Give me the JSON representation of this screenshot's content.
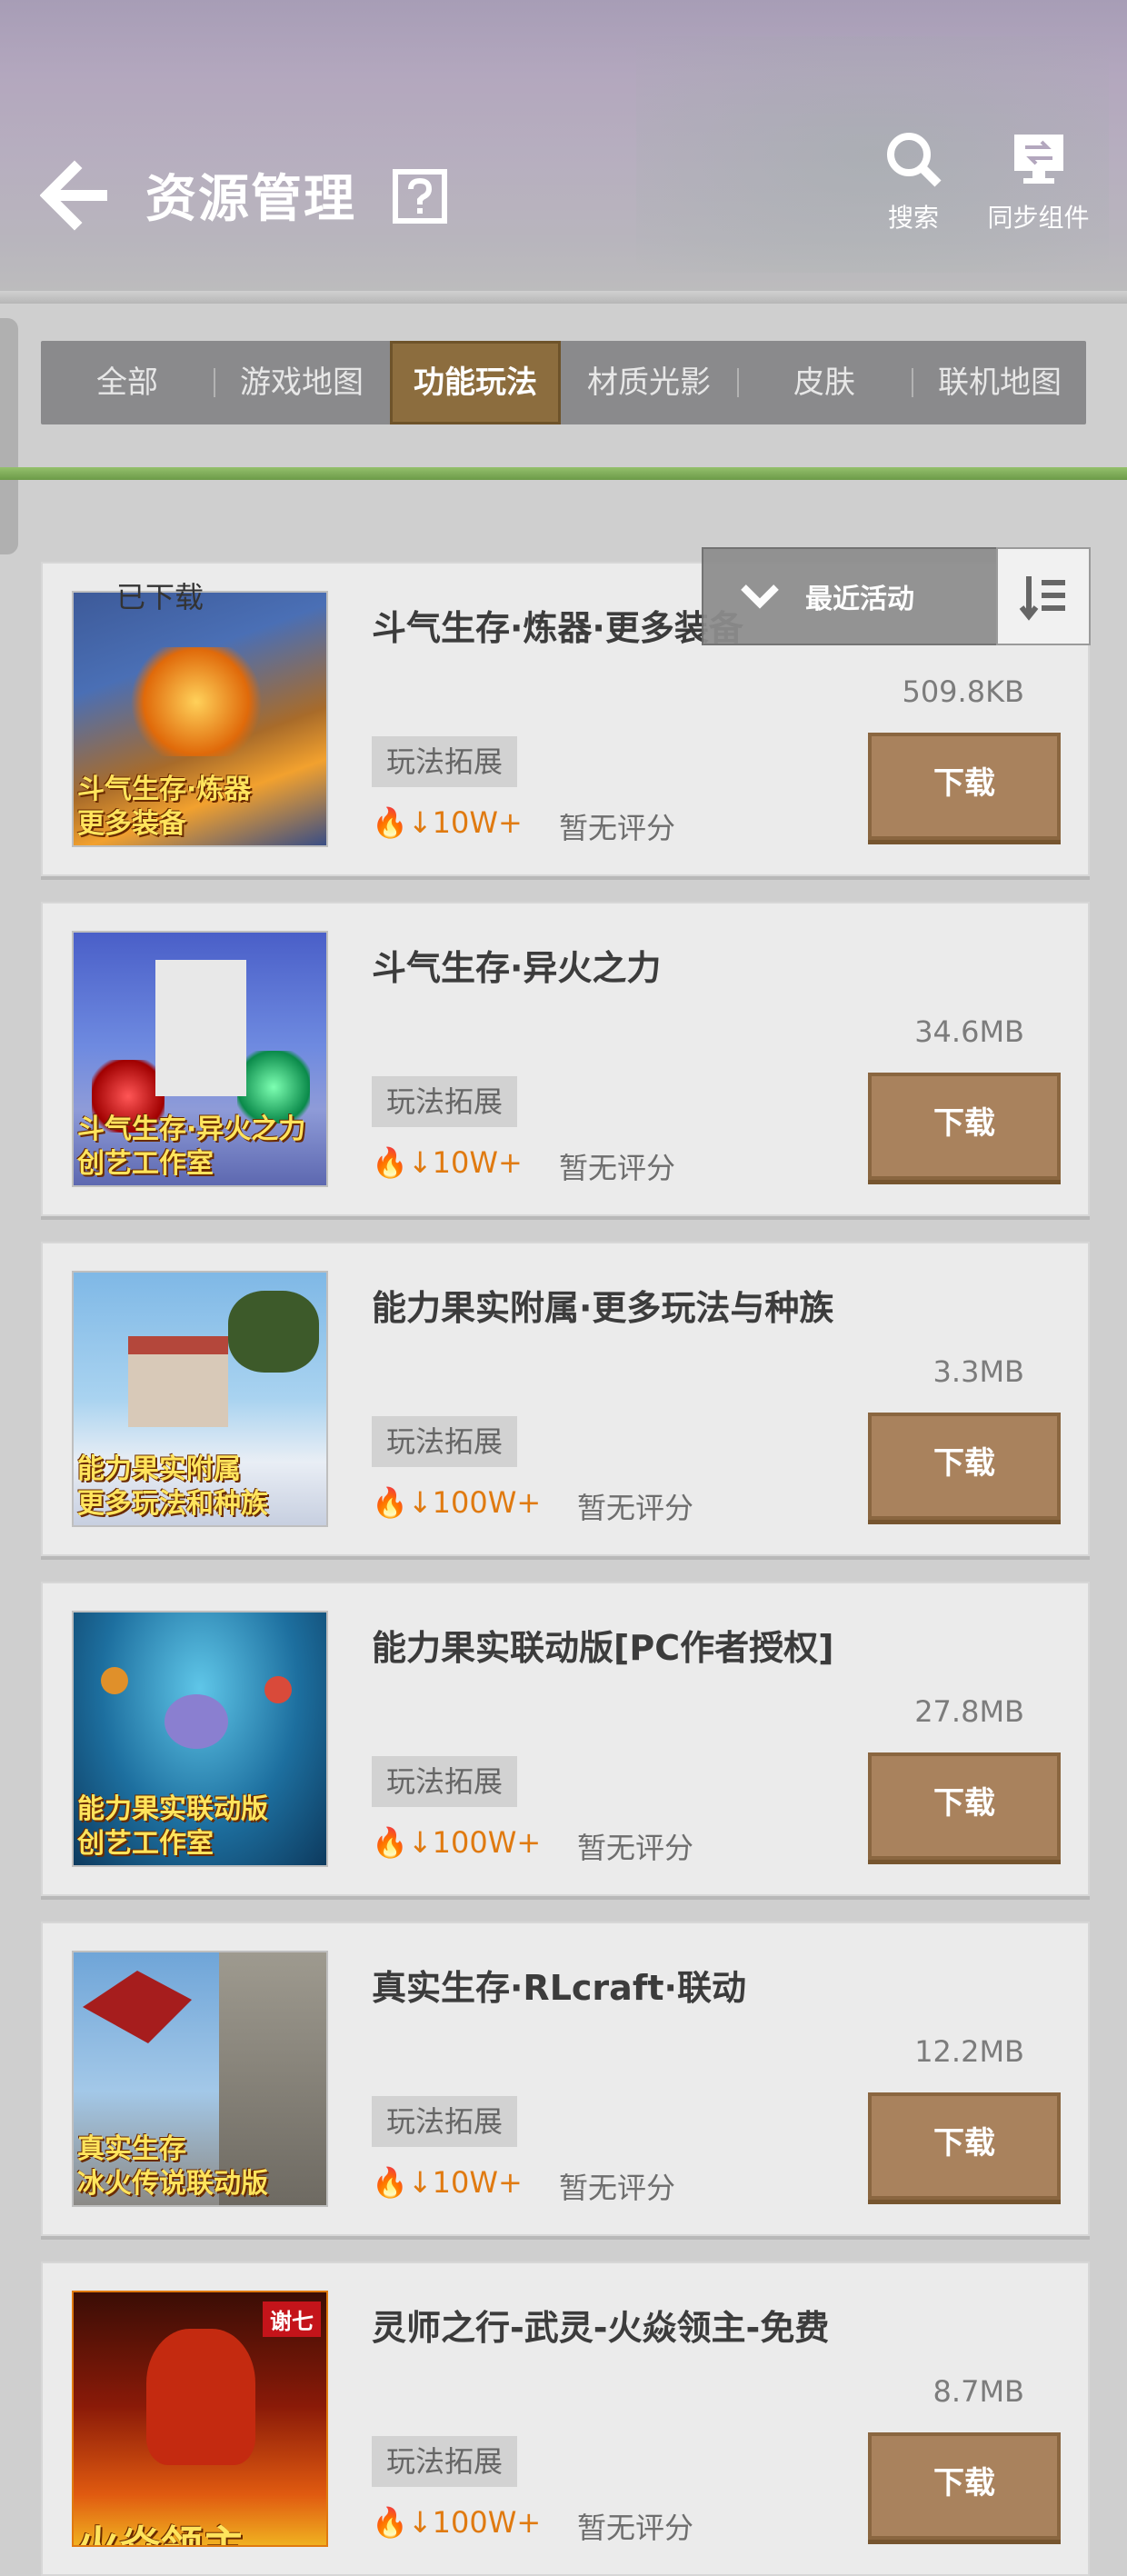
{
  "header": {
    "title": "资源管理",
    "search_label": "搜索",
    "sync_label": "同步组件"
  },
  "tabs": [
    {
      "label": "全部"
    },
    {
      "label": "游戏地图"
    },
    {
      "label": "功能玩法",
      "active": true
    },
    {
      "label": "材质光影"
    },
    {
      "label": "皮肤"
    },
    {
      "label": "联机地图"
    }
  ],
  "filters": {
    "downloaded_label": "已下载",
    "downloaded_checked": false,
    "sort_label": "最近活动"
  },
  "items": [
    {
      "title": "斗气生存·炼器·更多装备",
      "size": "509.8KB",
      "tag": "玩法拓展",
      "downloads": "10W+",
      "rating": "暂无评分",
      "button": "下载",
      "caption_1": "斗气生存·炼器",
      "caption_2": "更多装备"
    },
    {
      "title": "斗气生存·异火之力",
      "size": "34.6MB",
      "tag": "玩法拓展",
      "downloads": "10W+",
      "rating": "暂无评分",
      "button": "下载",
      "caption_1": "斗气生存·异火之力",
      "caption_2": "创艺工作室"
    },
    {
      "title": "能力果实附属·更多玩法与种族",
      "size": "3.3MB",
      "tag": "玩法拓展",
      "downloads": "100W+",
      "rating": "暂无评分",
      "button": "下载",
      "caption_1": "能力果实附属",
      "caption_2": "更多玩法和种族"
    },
    {
      "title": "能力果实联动版[PC作者授权]",
      "size": "27.8MB",
      "tag": "玩法拓展",
      "downloads": "100W+",
      "rating": "暂无评分",
      "button": "下载",
      "caption_1": "能力果实联动版",
      "caption_2": "创艺工作室"
    },
    {
      "title": "真实生存·RLcraft·联动",
      "size": "12.2MB",
      "tag": "玩法拓展",
      "downloads": "10W+",
      "rating": "暂无评分",
      "button": "下载",
      "caption_1": "真实生存",
      "caption_2": "冰火传说联动版"
    },
    {
      "title": "灵师之行-武灵-火焱领主-免费",
      "size": "8.7MB",
      "tag": "玩法拓展",
      "downloads": "100W+",
      "rating": "暂无评分",
      "button": "下载",
      "caption_1": "火焱领主",
      "caption_2": "",
      "badge": "谢七"
    }
  ],
  "colors": {
    "accent_brown": "#a9825d",
    "tab_active": "#8c6d3e",
    "green_bar": "#7fae57",
    "downloads_orange": "#e07a10"
  },
  "icons": {
    "back": "arrow-left-icon",
    "help": "question-mark-icon",
    "search": "search-icon",
    "sync": "sync-monitor-icon",
    "sort_dropdown": "chevron-down-icon",
    "sort_order": "sort-list-icon",
    "fire": "fire-icon",
    "download_arrow": "arrow-down-icon"
  }
}
